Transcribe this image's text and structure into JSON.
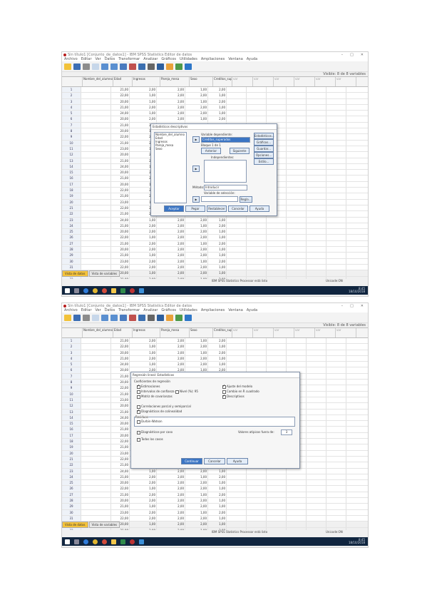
{
  "window": {
    "title": "Sin título1 [Conjunto_de_datos1] - IBM SPSS Statistics Editor de datos"
  },
  "menu": [
    "Archivo",
    "Editar",
    "Ver",
    "Datos",
    "Transformar",
    "Analizar",
    "Gráficos",
    "Utilidades",
    "Ampliaciones",
    "Ventana",
    "Ayuda"
  ],
  "visible_label": "Visible: 8 de 8 variables",
  "columns": [
    "Nombre_del_alumno",
    "Edad",
    "Ingresos",
    "Pareja_mesa",
    "Sexo",
    "Creditos_superados"
  ],
  "columns_short_2": [
    "Nombre_del_alumno",
    "Edad",
    "Ingresos",
    "Pareja_mesa",
    "Sexo",
    "Creditos_superados"
  ],
  "var_cols": [
    "var",
    "var",
    "var",
    "var",
    "var",
    "var"
  ],
  "rows": [
    [
      "1",
      "",
      "21,00",
      "2,00",
      "2,00",
      "1,00",
      "2,00"
    ],
    [
      "2",
      "",
      "22,00",
      "1,00",
      "2,00",
      "2,00",
      "1,00"
    ],
    [
      "3",
      "",
      "20,00",
      "1,00",
      "2,00",
      "1,00",
      "2,00"
    ],
    [
      "4",
      "",
      "21,00",
      "2,00",
      "2,00",
      "2,00",
      "1,00"
    ],
    [
      "5",
      "",
      "24,00",
      "1,00",
      "2,00",
      "2,00",
      "1,00"
    ],
    [
      "6",
      "",
      "20,00",
      "2,00",
      "2,00",
      "1,00",
      "2,00"
    ],
    [
      "7",
      "",
      "21,00",
      "2,00",
      "2,00",
      "2,00",
      "1,00"
    ],
    [
      "8",
      "",
      "20,00",
      "1,00",
      "2,00",
      "2,00",
      "1,00"
    ],
    [
      "9",
      "",
      "22,00",
      "2,00",
      "2,00",
      "1,00",
      "2,00"
    ],
    [
      "10",
      "",
      "21,00",
      "2,00",
      "2,00",
      "2,00",
      "1,00"
    ],
    [
      "11",
      "",
      "23,00",
      "1,00",
      "2,00",
      "2,00",
      "1,00"
    ],
    [
      "12",
      "",
      "20,00",
      "2,00",
      "2,00",
      "1,00",
      "2,00"
    ],
    [
      "13",
      "",
      "21,00",
      "2,00",
      "2,00",
      "2,00",
      "1,00"
    ],
    [
      "14",
      "",
      "24,00",
      "1,00",
      "2,00",
      "2,00",
      "1,00"
    ],
    [
      "15",
      "",
      "20,00",
      "2,00",
      "2,00",
      "1,00",
      "2,00"
    ],
    [
      "16",
      "",
      "21,00",
      "2,00",
      "2,00",
      "2,00",
      "1,00"
    ],
    [
      "17",
      "",
      "20,00",
      "1,00",
      "2,00",
      "2,00",
      "1,00"
    ],
    [
      "18",
      "",
      "22,00",
      "2,00",
      "2,00",
      "1,00",
      "2,00"
    ],
    [
      "19",
      "",
      "21,00",
      "2,00",
      "2,00",
      "2,00",
      "1,00"
    ],
    [
      "20",
      "",
      "23,00",
      "1,00",
      "2,00",
      "2,00",
      "1,00"
    ],
    [
      "21",
      "",
      "22,00",
      "2,00",
      "2,00",
      "1,00",
      "2,00"
    ],
    [
      "22",
      "",
      "21,00",
      "2,00",
      "2,00",
      "2,00",
      "1,00"
    ],
    [
      "23",
      "",
      "24,00",
      "1,00",
      "2,00",
      "2,00",
      "1,00"
    ],
    [
      "24",
      "",
      "21,00",
      "2,00",
      "2,00",
      "1,00",
      "2,00"
    ],
    [
      "25",
      "",
      "20,00",
      "2,00",
      "2,00",
      "2,00",
      "1,00"
    ],
    [
      "26",
      "",
      "22,00",
      "1,00",
      "2,00",
      "2,00",
      "1,00"
    ],
    [
      "27",
      "",
      "21,00",
      "2,00",
      "2,00",
      "1,00",
      "2,00"
    ],
    [
      "28",
      "",
      "20,00",
      "2,00",
      "2,00",
      "2,00",
      "1,00"
    ],
    [
      "29",
      "",
      "21,00",
      "1,00",
      "2,00",
      "2,00",
      "1,00"
    ],
    [
      "30",
      "",
      "23,00",
      "2,00",
      "2,00",
      "1,00",
      "2,00"
    ],
    [
      "31",
      "",
      "22,00",
      "2,00",
      "2,00",
      "2,00",
      "1,00"
    ],
    [
      "32",
      "",
      "20,00",
      "1,00",
      "2,00",
      "2,00",
      "1,00"
    ],
    [
      "33",
      "",
      "21,00",
      "2,00",
      "2,00",
      "1,00",
      "2,00"
    ]
  ],
  "tabs": [
    "Vista de datos",
    "Vista de variables"
  ],
  "status": {
    "left": "IBM SPSS Statistics Processor está listo",
    "right": "Unicode:ON"
  },
  "taskbar": {
    "time": "8:45",
    "date": "18/10/2018"
  },
  "dialog1": {
    "title": "Estadísticos descriptivos",
    "vars": [
      "Nombre_del_alumno",
      "Edad",
      "Ingresos",
      "Pareja_mesa",
      "Sexo"
    ],
    "dep_label": "Variable dependiente:",
    "dep_value": "Creditos_superados",
    "block": "Bloque 1 de 1",
    "prev": "Anterior",
    "next": "Siguiente",
    "indep_label": "Independientes:",
    "method_label": "Método:",
    "method_value": "Introducir",
    "sel_label": "Variable de selección:",
    "rule_btn": "Regla...",
    "case_label": "Etiquetas de casos:",
    "wls_label": "Ponderación MCP:",
    "side_buttons": [
      "Estadísticos...",
      "Gráficos...",
      "Guardar...",
      "Opciones...",
      "Estilo..."
    ],
    "bottom_buttons": [
      "Aceptar",
      "Pegar",
      "Restablecer",
      "Cancelar",
      "Ayuda"
    ]
  },
  "dialog2": {
    "title": "Regresión lineal: Estadísticos",
    "group1": "Coeficientes de regresión",
    "checks": [
      {
        "label": "Estimaciones",
        "on": true
      },
      {
        "label": "Intervalos de confianza",
        "on": false
      },
      {
        "label": "Nivel (%): 95",
        "on": false
      },
      {
        "label": "Matriz de covarianzas",
        "on": false
      },
      {
        "label": "Ajuste del modelo",
        "on": true
      },
      {
        "label": "Cambio en R cuadrado",
        "on": false
      },
      {
        "label": "Descriptivos",
        "on": true
      },
      {
        "label": "Correlaciones parcial y semiparcial",
        "on": false
      },
      {
        "label": "Diagnósticos de colinealidad",
        "on": true
      }
    ],
    "residuals": "Residuos",
    "dw": "Durbin-Watson",
    "casewise": "Diagnósticos por caso",
    "outliers": "Valores atípicos fuera de:",
    "outliers_val": "3",
    "all_cases": "Todos los casos",
    "buttons": [
      "Continuar",
      "Cancelar",
      "Ayuda"
    ]
  }
}
